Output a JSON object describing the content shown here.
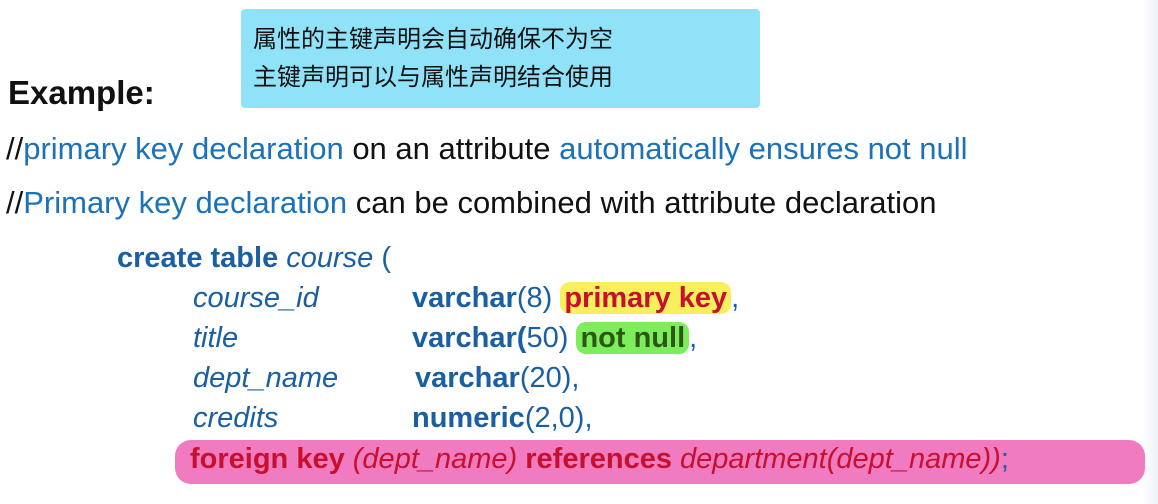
{
  "callout": {
    "line1": "属性的主键声明会自动确保不为空",
    "line2": "主键声明可以与属性声明结合使用"
  },
  "heading": "Example:",
  "comment1": {
    "prefix": "//",
    "part1": "primary key declaration",
    "part2": " on an attribute ",
    "part3": "automatically ensures not null"
  },
  "comment2": {
    "prefix": "//",
    "part1": "Primary key declaration",
    "part2": " can be combined with attribute declaration"
  },
  "code": {
    "create": "create table",
    "table_name": "course",
    "open_paren": " (",
    "rows": [
      {
        "name": "course_id",
        "type": "varchar",
        "args": "(8)",
        "constraint": "primary key",
        "tail": ","
      },
      {
        "name": "title",
        "type": "varchar(",
        "args": "50)",
        "constraint": "not null",
        "tail": ","
      },
      {
        "name": "dept_name",
        "type": "varchar",
        "args": "(20),",
        "constraint": "",
        "tail": ""
      },
      {
        "name": "credits",
        "type": "numeric",
        "args": "(2,0),",
        "constraint": "",
        "tail": ""
      }
    ],
    "fk": {
      "kw1": "foreign key",
      "arg1": " (dept_name) ",
      "kw2": "references",
      "arg2": " department(dept_name))",
      "end": ";"
    }
  },
  "colors": {
    "callout_bg": "#8fe2f7",
    "blue_text": "#1b72b9",
    "code_blue": "#1b5fa3",
    "red_text": "#c8102e",
    "yellow_highlight": "#f7ef5b",
    "green_highlight": "#7ded5d",
    "pink_highlight": "#f07bc0"
  }
}
